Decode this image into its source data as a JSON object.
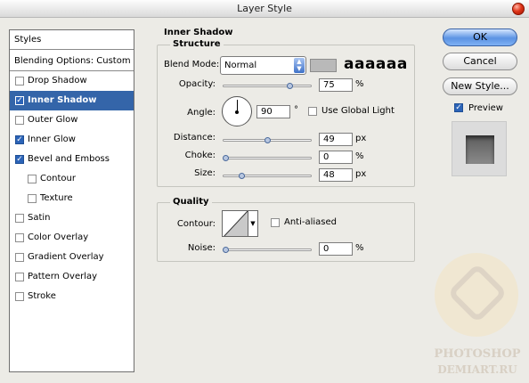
{
  "window": {
    "title": "Layer Style"
  },
  "style_list": {
    "header": "Styles",
    "blending_options": "Blending Options: Custom",
    "items": [
      {
        "label": "Drop Shadow",
        "checked": false,
        "selected": false,
        "indent": false
      },
      {
        "label": "Inner Shadow",
        "checked": true,
        "selected": true,
        "indent": false
      },
      {
        "label": "Outer Glow",
        "checked": false,
        "selected": false,
        "indent": false
      },
      {
        "label": "Inner Glow",
        "checked": true,
        "selected": false,
        "indent": false
      },
      {
        "label": "Bevel and Emboss",
        "checked": true,
        "selected": false,
        "indent": false
      },
      {
        "label": "Contour",
        "checked": false,
        "selected": false,
        "indent": true
      },
      {
        "label": "Texture",
        "checked": false,
        "selected": false,
        "indent": true
      },
      {
        "label": "Satin",
        "checked": false,
        "selected": false,
        "indent": false
      },
      {
        "label": "Color Overlay",
        "checked": false,
        "selected": false,
        "indent": false
      },
      {
        "label": "Gradient Overlay",
        "checked": false,
        "selected": false,
        "indent": false
      },
      {
        "label": "Pattern Overlay",
        "checked": false,
        "selected": false,
        "indent": false
      },
      {
        "label": "Stroke",
        "checked": false,
        "selected": false,
        "indent": false
      }
    ]
  },
  "inner_shadow": {
    "section_title": "Inner Shadow",
    "structure_title": "Structure",
    "blend_mode_label": "Blend Mode:",
    "blend_mode_value": "Normal",
    "shadow_color": "#b9b9b9",
    "sample_text": "aaaaaa",
    "opacity_label": "Opacity:",
    "opacity_value": "75",
    "opacity_unit": "%",
    "opacity_fraction": 0.75,
    "angle_label": "Angle:",
    "angle_value": "90",
    "angle_unit": "°",
    "use_global_light_label": "Use Global Light",
    "use_global_light_checked": false,
    "distance_label": "Distance:",
    "distance_value": "49",
    "distance_unit": "px",
    "distance_fraction": 0.49,
    "choke_label": "Choke:",
    "choke_value": "0",
    "choke_unit": "%",
    "choke_fraction": 0.0,
    "size_label": "Size:",
    "size_value": "48",
    "size_unit": "px",
    "size_fraction": 0.19
  },
  "quality": {
    "title": "Quality",
    "contour_label": "Contour:",
    "anti_aliased_label": "Anti-aliased",
    "anti_aliased_checked": false,
    "noise_label": "Noise:",
    "noise_value": "0",
    "noise_unit": "%",
    "noise_fraction": 0.0
  },
  "buttons": {
    "ok": "OK",
    "cancel": "Cancel",
    "new_style": "New Style...",
    "preview_label": "Preview",
    "preview_checked": true
  },
  "watermark": {
    "line1": "PHOTOSHOP",
    "line2": "DEMIART.RU"
  },
  "colors": {
    "selected_row": "#3465a9",
    "ok_button": "#5b93e3"
  }
}
